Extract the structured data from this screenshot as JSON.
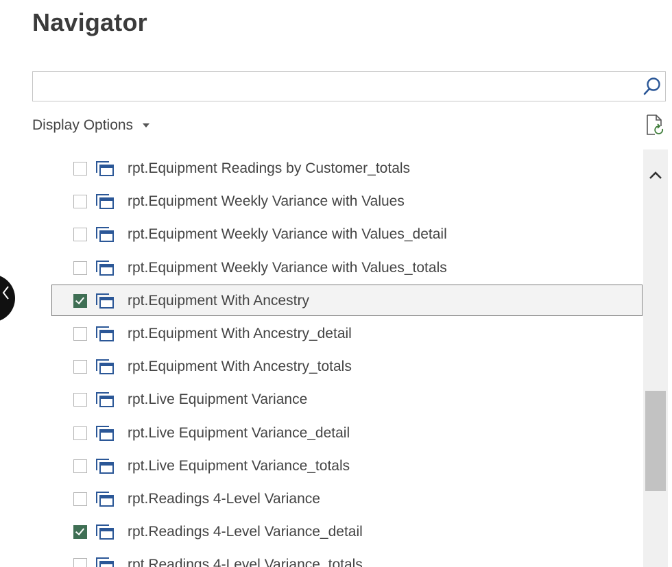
{
  "window": {
    "title": "Navigator"
  },
  "search": {
    "value": "",
    "placeholder": ""
  },
  "toolbar": {
    "display_options_label": "Display Options"
  },
  "icons": {
    "search": "search-icon",
    "refresh": "refresh-icon",
    "table": "table-icon",
    "scroll_up": "chevron-up-icon",
    "back": "chevron-left-icon"
  },
  "colors": {
    "checkbox_checked": "#3f6f54",
    "table_icon": "#2b5797",
    "selected_border": "#7a7a7a",
    "scroll_thumb": "#c2c2c2"
  },
  "items": [
    {
      "label": "rpt.Equipment Readings by Customer_totals",
      "checked": false,
      "selected": false
    },
    {
      "label": "rpt.Equipment Weekly Variance with Values",
      "checked": false,
      "selected": false
    },
    {
      "label": "rpt.Equipment Weekly Variance with Values_detail",
      "checked": false,
      "selected": false
    },
    {
      "label": "rpt.Equipment Weekly Variance with Values_totals",
      "checked": false,
      "selected": false
    },
    {
      "label": "rpt.Equipment With Ancestry",
      "checked": true,
      "selected": true
    },
    {
      "label": "rpt.Equipment With Ancestry_detail",
      "checked": false,
      "selected": false
    },
    {
      "label": "rpt.Equipment With Ancestry_totals",
      "checked": false,
      "selected": false
    },
    {
      "label": "rpt.Live Equipment Variance",
      "checked": false,
      "selected": false
    },
    {
      "label": "rpt.Live Equipment Variance_detail",
      "checked": false,
      "selected": false
    },
    {
      "label": "rpt.Live Equipment Variance_totals",
      "checked": false,
      "selected": false
    },
    {
      "label": "rpt.Readings 4-Level Variance",
      "checked": false,
      "selected": false
    },
    {
      "label": "rpt.Readings 4-Level Variance_detail",
      "checked": true,
      "selected": false
    },
    {
      "label": "rpt.Readings 4-Level Variance_totals",
      "checked": false,
      "selected": false
    }
  ]
}
